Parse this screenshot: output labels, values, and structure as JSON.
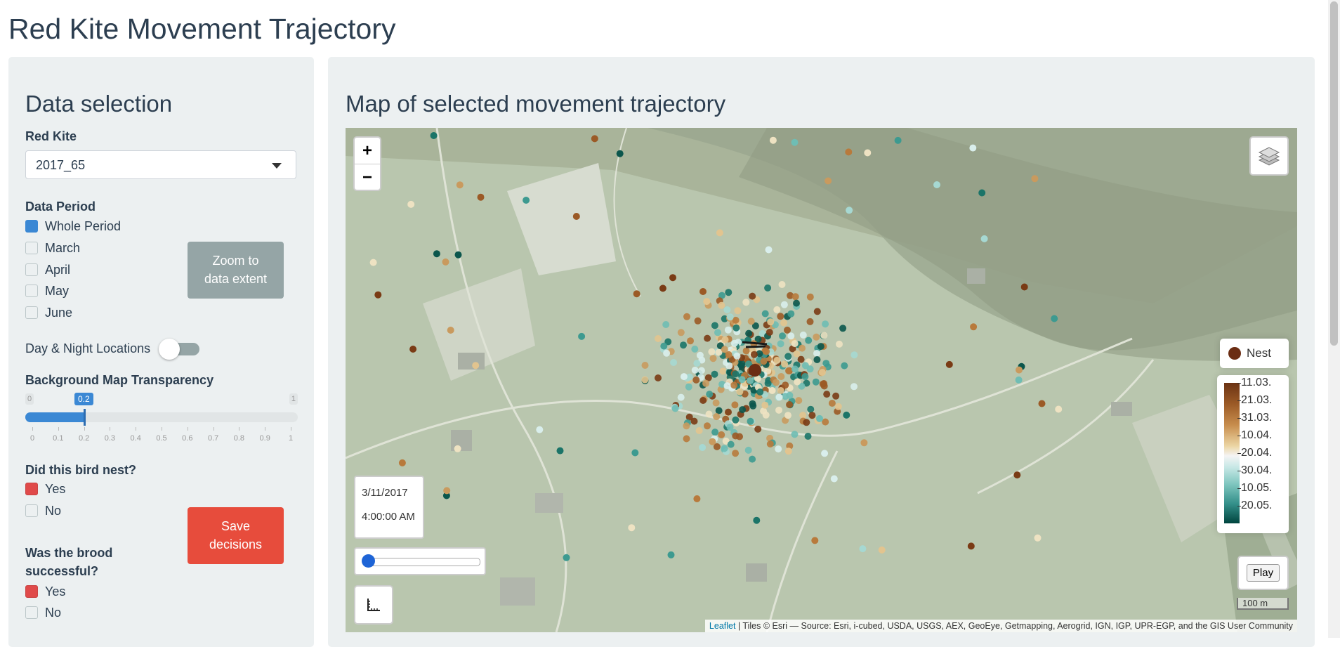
{
  "page": {
    "title": "Red Kite Movement Trajectory"
  },
  "sidebar": {
    "heading": "Data selection",
    "kite_label": "Red Kite",
    "kite_value": "2017_65",
    "period_label": "Data Period",
    "periods": [
      {
        "label": "Whole Period",
        "checked": true
      },
      {
        "label": "March",
        "checked": false
      },
      {
        "label": "April",
        "checked": false
      },
      {
        "label": "May",
        "checked": false
      },
      {
        "label": "June",
        "checked": false
      }
    ],
    "zoom_button_line1": "Zoom to",
    "zoom_button_line2": "data extent",
    "daynight_label": "Day & Night Locations",
    "daynight_on": false,
    "transparency_label": "Background Map Transparency",
    "transparency": {
      "min": "0",
      "max": "1",
      "value": "0.2"
    },
    "transparency_ticks": [
      "0",
      "0.1",
      "0.2",
      "0.3",
      "0.4",
      "0.5",
      "0.6",
      "0.7",
      "0.8",
      "0.9",
      "1"
    ],
    "nest_question": "Did this bird nest?",
    "nest_yes": "Yes",
    "nest_no": "No",
    "save_line1": "Save",
    "save_line2": "decisions",
    "brood_question_line1": "Was the brood",
    "brood_question_line2": "successful?",
    "brood_yes": "Yes",
    "brood_no": "No"
  },
  "main": {
    "heading": "Map of selected movement trajectory",
    "zoom_in": "+",
    "zoom_out": "−",
    "legend_nest": "Nest",
    "legend_dates": [
      "11.03.",
      "21.03.",
      "31.03.",
      "10.04.",
      "20.04.",
      "30.04.",
      "10.05.",
      "20.05."
    ],
    "time_date": "3/11/2017",
    "time_clock": "4:00:00 AM",
    "play_label": "Play",
    "scale_label": "100 m",
    "attribution_link": "Leaflet",
    "attribution_text": " | Tiles © Esri — Source: Esri, i-cubed, USDA, USGS, AEX, GeoEye, Getmapping, Aerogrid, IGN, IGP, UPR-EGP, and the GIS User Community"
  },
  "colors": {
    "accent_blue": "#3b88d4",
    "save_red": "#e74c3c",
    "checked_red": "#e04a4a",
    "zoom_grey": "#95a5a6",
    "nest_brown": "#6b2d13"
  }
}
